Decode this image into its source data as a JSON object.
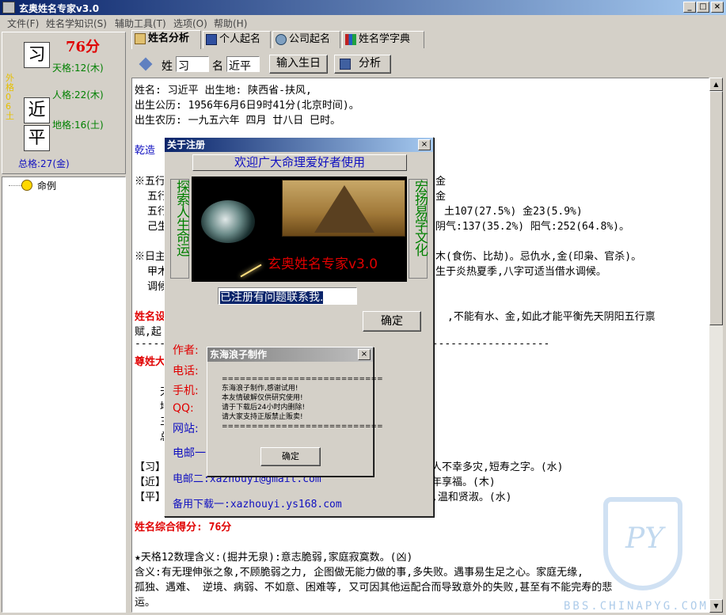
{
  "window": {
    "title": "玄奥姓名专家v3.0",
    "min": "_",
    "max": "□",
    "close": "×"
  },
  "menu": [
    "文件(F)",
    "姓名学知识(S)",
    "辅助工具(T)",
    "选项(O)",
    "帮助(H)"
  ],
  "left": {
    "score": "76分",
    "surname": "习",
    "given1": "近",
    "given2": "平",
    "waige_vertical": "外格06土",
    "tiange": "天格:12(木)",
    "renge": "人格:22(木)",
    "dige": "地格:16(土)",
    "zongge": "总格:27(金)",
    "tree_item": "命例"
  },
  "tabs": [
    "姓名分析",
    "个人起名",
    "公司起名",
    "姓名学字典"
  ],
  "form": {
    "surname_label": "姓",
    "surname_value": "习",
    "name_label": "名",
    "name_value": "近平",
    "birth_button": "输入生日",
    "analyze_button": "分析"
  },
  "content": {
    "l1": "姓名: 习近平   出生地: 陕西省-扶风,",
    "l2": "出生公历: 1956年6月6日9时41分(北京时间)。",
    "l3": "出生农历: 一九五六年  四月  廿八日  巳时。",
    "l4": "乾造",
    "l5": "※五行",
    "l5r": "金",
    "l6": "五行",
    "l6r": "金",
    "l7": "五行",
    "l7r": "土107(27.5%)  金23(5.9%)",
    "l8": "己生",
    "l8r": "阴气:137(35.2%)   阳气:252(64.8%)。",
    "l9": "※日主",
    "l9r": "木(食伤、比劫)。忌仇水,金(印枭、官杀)。",
    "l10": "甲木",
    "l10r": "生于炎热夏季,八字可适当借水调候。",
    "l11": "调候",
    "l12": "姓名设",
    "l12r": ",不能有水、金,如此才能平衡先天阴阳五行禀",
    "l13": "赋,起",
    "l14": "-------------------------------------------------------------------",
    "l15": "尊姓大",
    "l16a": "天",
    "l16b": "地",
    "l16c": "三",
    "l16d": "总",
    "l17": "【习】",
    "l17r": "人不幸多灾,短寿之字。(水)",
    "l18": "【近】",
    "l18r": "年享福。(木)",
    "l19": "【平】",
    "l19r": ",温和贤淑。(水)",
    "l20": "姓名综合得分: 76分",
    "l21": "★天格12数理含义:(掘井无泉):意志脆弱,家庭寂寞数。(凶)",
    "l22": "     含义:有无理伸张之象,不顾脆弱之力,  企图做无能力做的事,多失败。遇事易生足之心。家庭无缘,",
    "l23": "孤独、遇难、  逆境、病弱、不如意、困难等,   又可因其他运配合而导致意外的失败,甚至有不能完寿的悲",
    "l24": "运。"
  },
  "reg_dialog": {
    "title": "关于注册",
    "close": "×",
    "welcome": "欢迎广大命理爱好者使用",
    "left_vertical": "探索人生命运",
    "right_vertical": "宏扬易学文化",
    "banner_text": "玄奥姓名专家v3.0",
    "input_text": "已注册有问题联系我.",
    "ok": "确定",
    "author": "作者:",
    "phone": "电话:",
    "mobile": "手机:",
    "qq": "QQ:",
    "website": "网站:",
    "email1": "电邮一",
    "email2": "电邮二:xazhouyi@gmail.com",
    "download": "备用下载一:xazhouyi.ys168.com"
  },
  "crack_dialog": {
    "title": "东海浪子制作",
    "close": "×",
    "sep1": "===========================",
    "line1": "东海浪子制作,感谢试用!",
    "line2": "本友情破解仅供研究使用!",
    "line3": "请于下载后24小时内删除!",
    "line4": "请大家支持正版禁止贩卖!",
    "sep2": "===========================",
    "ok": "确定"
  },
  "watermark": {
    "text": "BBS.CHINAPYG.COM",
    "logo": "PY"
  },
  "colors": {
    "title_blue": "#0a246a",
    "score_red": "#e00000",
    "text_green": "#008000",
    "link_blue": "#1010c0"
  }
}
